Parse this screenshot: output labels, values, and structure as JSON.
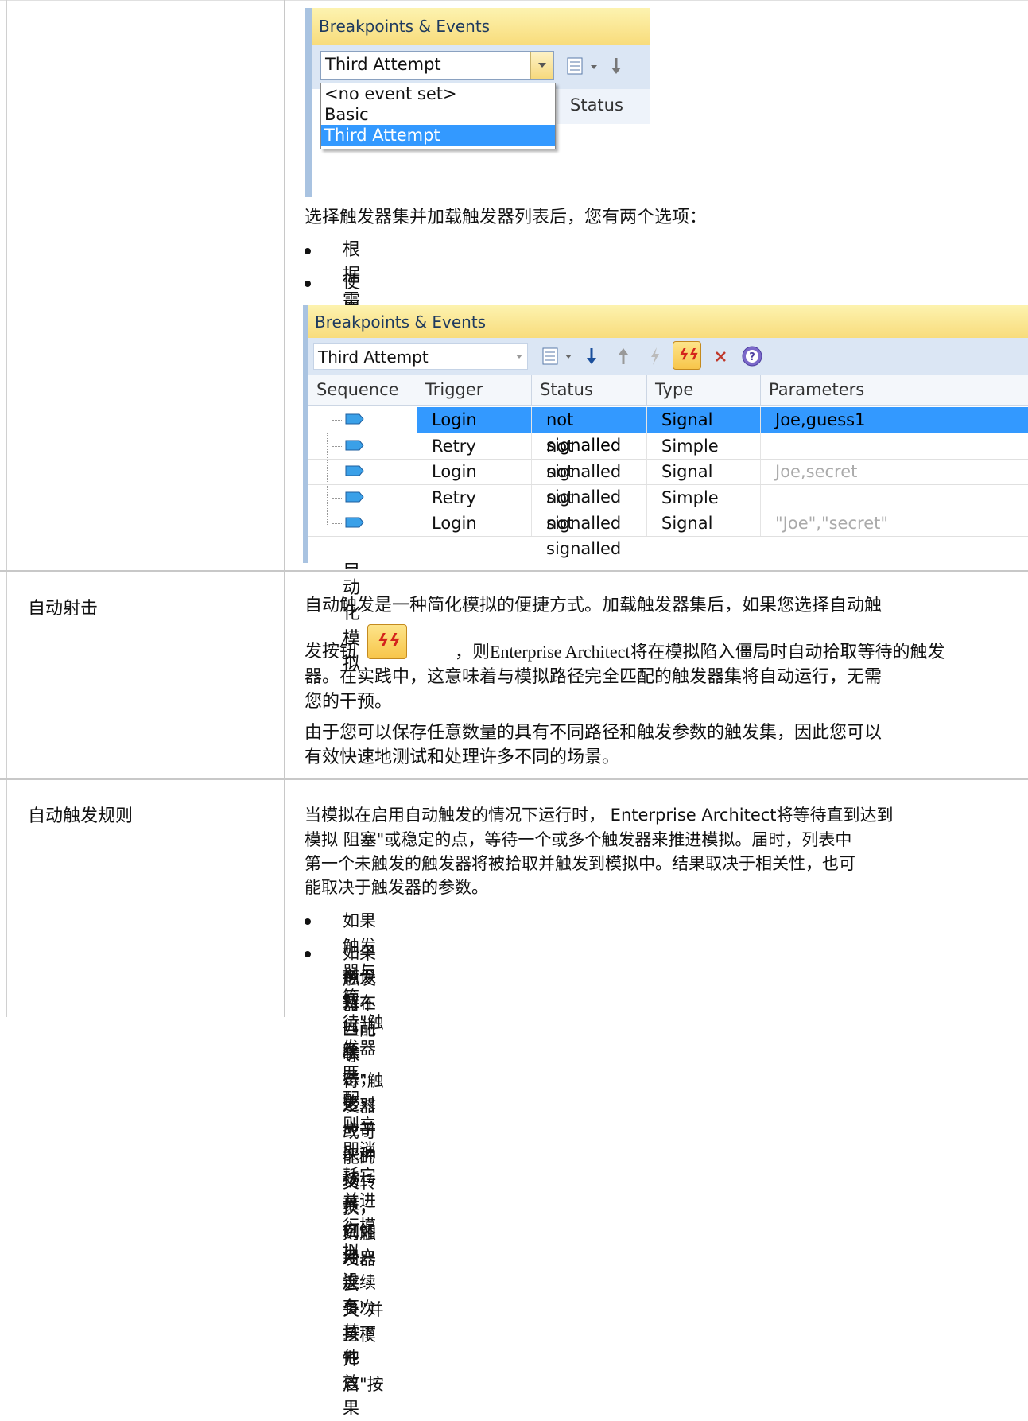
{
  "screenshot1": {
    "title": "Breakpoints & Events",
    "combo_value": "Third Attempt",
    "dropdown_options": [
      "<no event set>",
      "Basic",
      "Third Attempt"
    ],
    "status_header": "Status"
  },
  "intro": {
    "text": "选择触发器集并加载触发器列表后，您有两个选项：",
    "bullets": [
      "根据需要手动触发触发器",
      "使用自动触发特征来完全自动化模拟"
    ]
  },
  "screenshot2": {
    "title": "Breakpoints & Events",
    "combo_value": "Third Attempt",
    "columns": [
      "Sequence",
      "Trigger",
      "Status",
      "Type",
      "Parameters"
    ],
    "rows": [
      {
        "trigger": "Login",
        "status": "not signalled",
        "type": "Signal",
        "params": "Joe,guess1"
      },
      {
        "trigger": "Retry",
        "status": "not signalled",
        "type": "Simple",
        "params": ""
      },
      {
        "trigger": "Login",
        "status": "not signalled",
        "type": "Signal",
        "params": "Joe,secret"
      },
      {
        "trigger": "Retry",
        "status": "not signalled",
        "type": "Simple",
        "params": ""
      },
      {
        "trigger": "Login",
        "status": "not signalled",
        "type": "Signal",
        "params": "\"Joe\",\"secret\""
      }
    ]
  },
  "autofire": {
    "label": "自动射击",
    "p1_line1": "自动触发是一种简化模拟的便捷方式。加载触发器集后，如果您选择自动触",
    "p1_pre": "发按钮",
    "p1_post": "，则Enterprise Architect将在模拟陷入僵局时自动拾取等待的触发",
    "p1_line3": "器。在实践中，这意味着与模拟路径完全匹配的触发器集将自动运行，无需",
    "p1_line4": "您的干预。",
    "p2_line1": "由于您可以保存任意数量的具有不同路径和触发参数的触发集，因此您可以",
    "p2_line2": "有效快速地测试和处理许多不同的场景。"
  },
  "rules": {
    "label": "自动触发规则",
    "p_lines": [
      "当模拟在启用自动触发的情况下运行时， Enterprise Architect将等待直到达到",
      "模拟 阻塞\"或稳定的点，等待一个或多个触发器来推进模拟。届时，列表中",
      "第一个未触发的触发器将被拾取并触发到模拟中。结果取决于相关性，也可",
      "能取决于触发器的参数。"
    ],
    "bullet1": "如果触发器与 等待\"触发器匹配，则立即消耗它并进行模拟",
    "bullet2_lines": [
      "如果触发器不匹配 等待\"触发器或可能的父转换，则触发器 丢失\"并且模",
      "拟保持在当前状态；这对应于一种场景，例如用户连续多次按下 开启\"按",
      "钮 - 除了第一次按下之外没有其他效果"
    ]
  }
}
